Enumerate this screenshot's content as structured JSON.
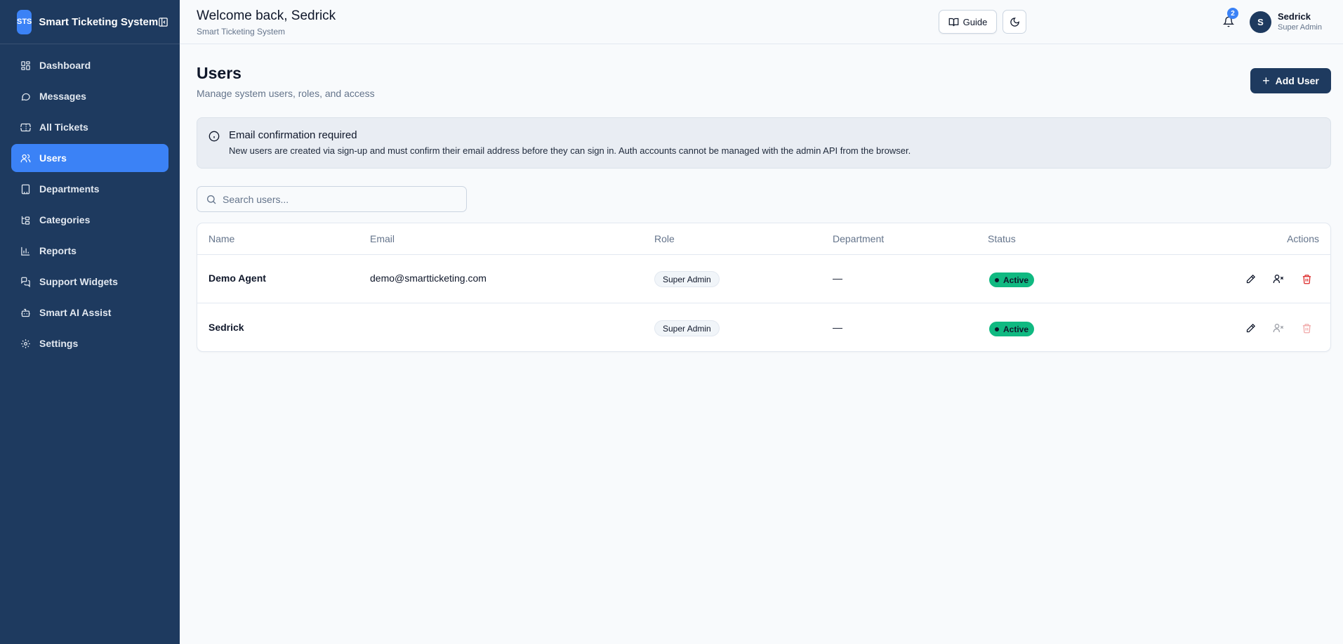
{
  "brand": {
    "logo_text": "STS",
    "name": "Smart Ticketing System"
  },
  "sidebar": {
    "items": [
      {
        "label": "Dashboard",
        "icon": "dashboard-icon"
      },
      {
        "label": "Messages",
        "icon": "message-icon"
      },
      {
        "label": "All Tickets",
        "icon": "ticket-icon"
      },
      {
        "label": "Users",
        "icon": "users-icon",
        "active": true
      },
      {
        "label": "Departments",
        "icon": "building-icon"
      },
      {
        "label": "Categories",
        "icon": "tree-icon"
      },
      {
        "label": "Reports",
        "icon": "bar-chart-icon"
      },
      {
        "label": "Support Widgets",
        "icon": "widget-icon"
      },
      {
        "label": "Smart AI Assist",
        "icon": "bot-icon"
      },
      {
        "label": "Settings",
        "icon": "gear-icon"
      }
    ]
  },
  "header": {
    "welcome": "Welcome back, Sedrick",
    "subtitle": "Smart Ticketing System",
    "guide_label": "Guide",
    "notification_count": "2",
    "user": {
      "initial": "S",
      "name": "Sedrick",
      "role": "Super Admin"
    }
  },
  "page": {
    "title": "Users",
    "subtitle": "Manage system users, roles, and access",
    "add_button": "Add User"
  },
  "alert": {
    "title": "Email confirmation required",
    "text": "New users are created via sign-up and must confirm their email address before they can sign in. Auth accounts cannot be managed with the admin API from the browser."
  },
  "search": {
    "placeholder": "Search users..."
  },
  "table": {
    "columns": [
      "Name",
      "Email",
      "Role",
      "Department",
      "Status",
      "Actions"
    ],
    "rows": [
      {
        "name": "Demo Agent",
        "email": "demo@smartticketing.com",
        "role": "Super Admin",
        "department": "—",
        "status": "Active"
      },
      {
        "name": "Sedrick",
        "email": "",
        "role": "Super Admin",
        "department": "—",
        "status": "Active"
      }
    ]
  },
  "colors": {
    "sidebar_bg": "#1e3a5f",
    "accent": "#3b82f6",
    "status_active": "#10b981",
    "danger": "#dc2626"
  }
}
